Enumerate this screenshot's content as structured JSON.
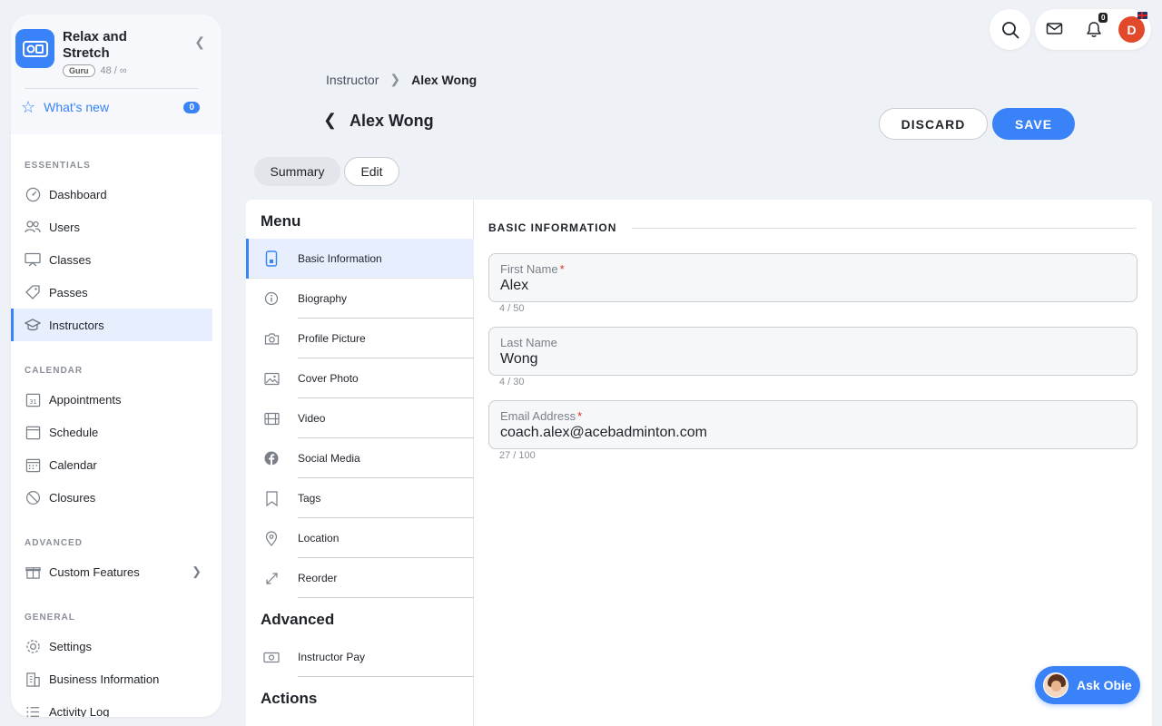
{
  "app": {
    "name": "Relax and Stretch",
    "tier": "Guru",
    "count": "48 / ∞"
  },
  "whats_new": {
    "label": "What's new",
    "badge": "0"
  },
  "sidebar": {
    "sections": [
      {
        "heading": "ESSENTIALS",
        "items": [
          "Dashboard",
          "Users",
          "Classes",
          "Passes",
          "Instructors"
        ]
      },
      {
        "heading": "CALENDAR",
        "items": [
          "Appointments",
          "Schedule",
          "Calendar",
          "Closures"
        ]
      },
      {
        "heading": "ADVANCED",
        "items": [
          "Custom Features"
        ]
      },
      {
        "heading": "GENERAL",
        "items": [
          "Settings",
          "Business Information",
          "Activity Log"
        ]
      }
    ],
    "active_item": "Instructors"
  },
  "topbar": {
    "notification_count": "0",
    "avatar_initial": "D"
  },
  "breadcrumb": {
    "parent": "Instructor",
    "current": "Alex Wong"
  },
  "page": {
    "title": "Alex Wong",
    "discard_label": "DISCARD",
    "save_label": "SAVE",
    "tabs": [
      "Summary",
      "Edit"
    ],
    "active_tab": "Summary"
  },
  "menu": {
    "heading": "Menu",
    "items": [
      "Basic Information",
      "Biography",
      "Profile Picture",
      "Cover Photo",
      "Video",
      "Social Media",
      "Tags",
      "Location",
      "Reorder"
    ],
    "active_item": "Basic Information",
    "advanced_heading": "Advanced",
    "advanced_items": [
      "Instructor Pay"
    ],
    "actions_heading": "Actions"
  },
  "form": {
    "section_title": "BASIC INFORMATION",
    "fields": [
      {
        "label": "First Name",
        "required": true,
        "value": "Alex",
        "counter": "4 / 50"
      },
      {
        "label": "Last Name",
        "required": false,
        "value": "Wong",
        "counter": "4 / 30"
      },
      {
        "label": "Email Address",
        "required": true,
        "value": "coach.alex@acebadminton.com",
        "counter": "27 / 100"
      }
    ]
  },
  "assistant": {
    "label": "Ask Obie"
  },
  "colors": {
    "accent": "#3a82f7",
    "avatar": "#e2492a",
    "required": "#d93025"
  }
}
